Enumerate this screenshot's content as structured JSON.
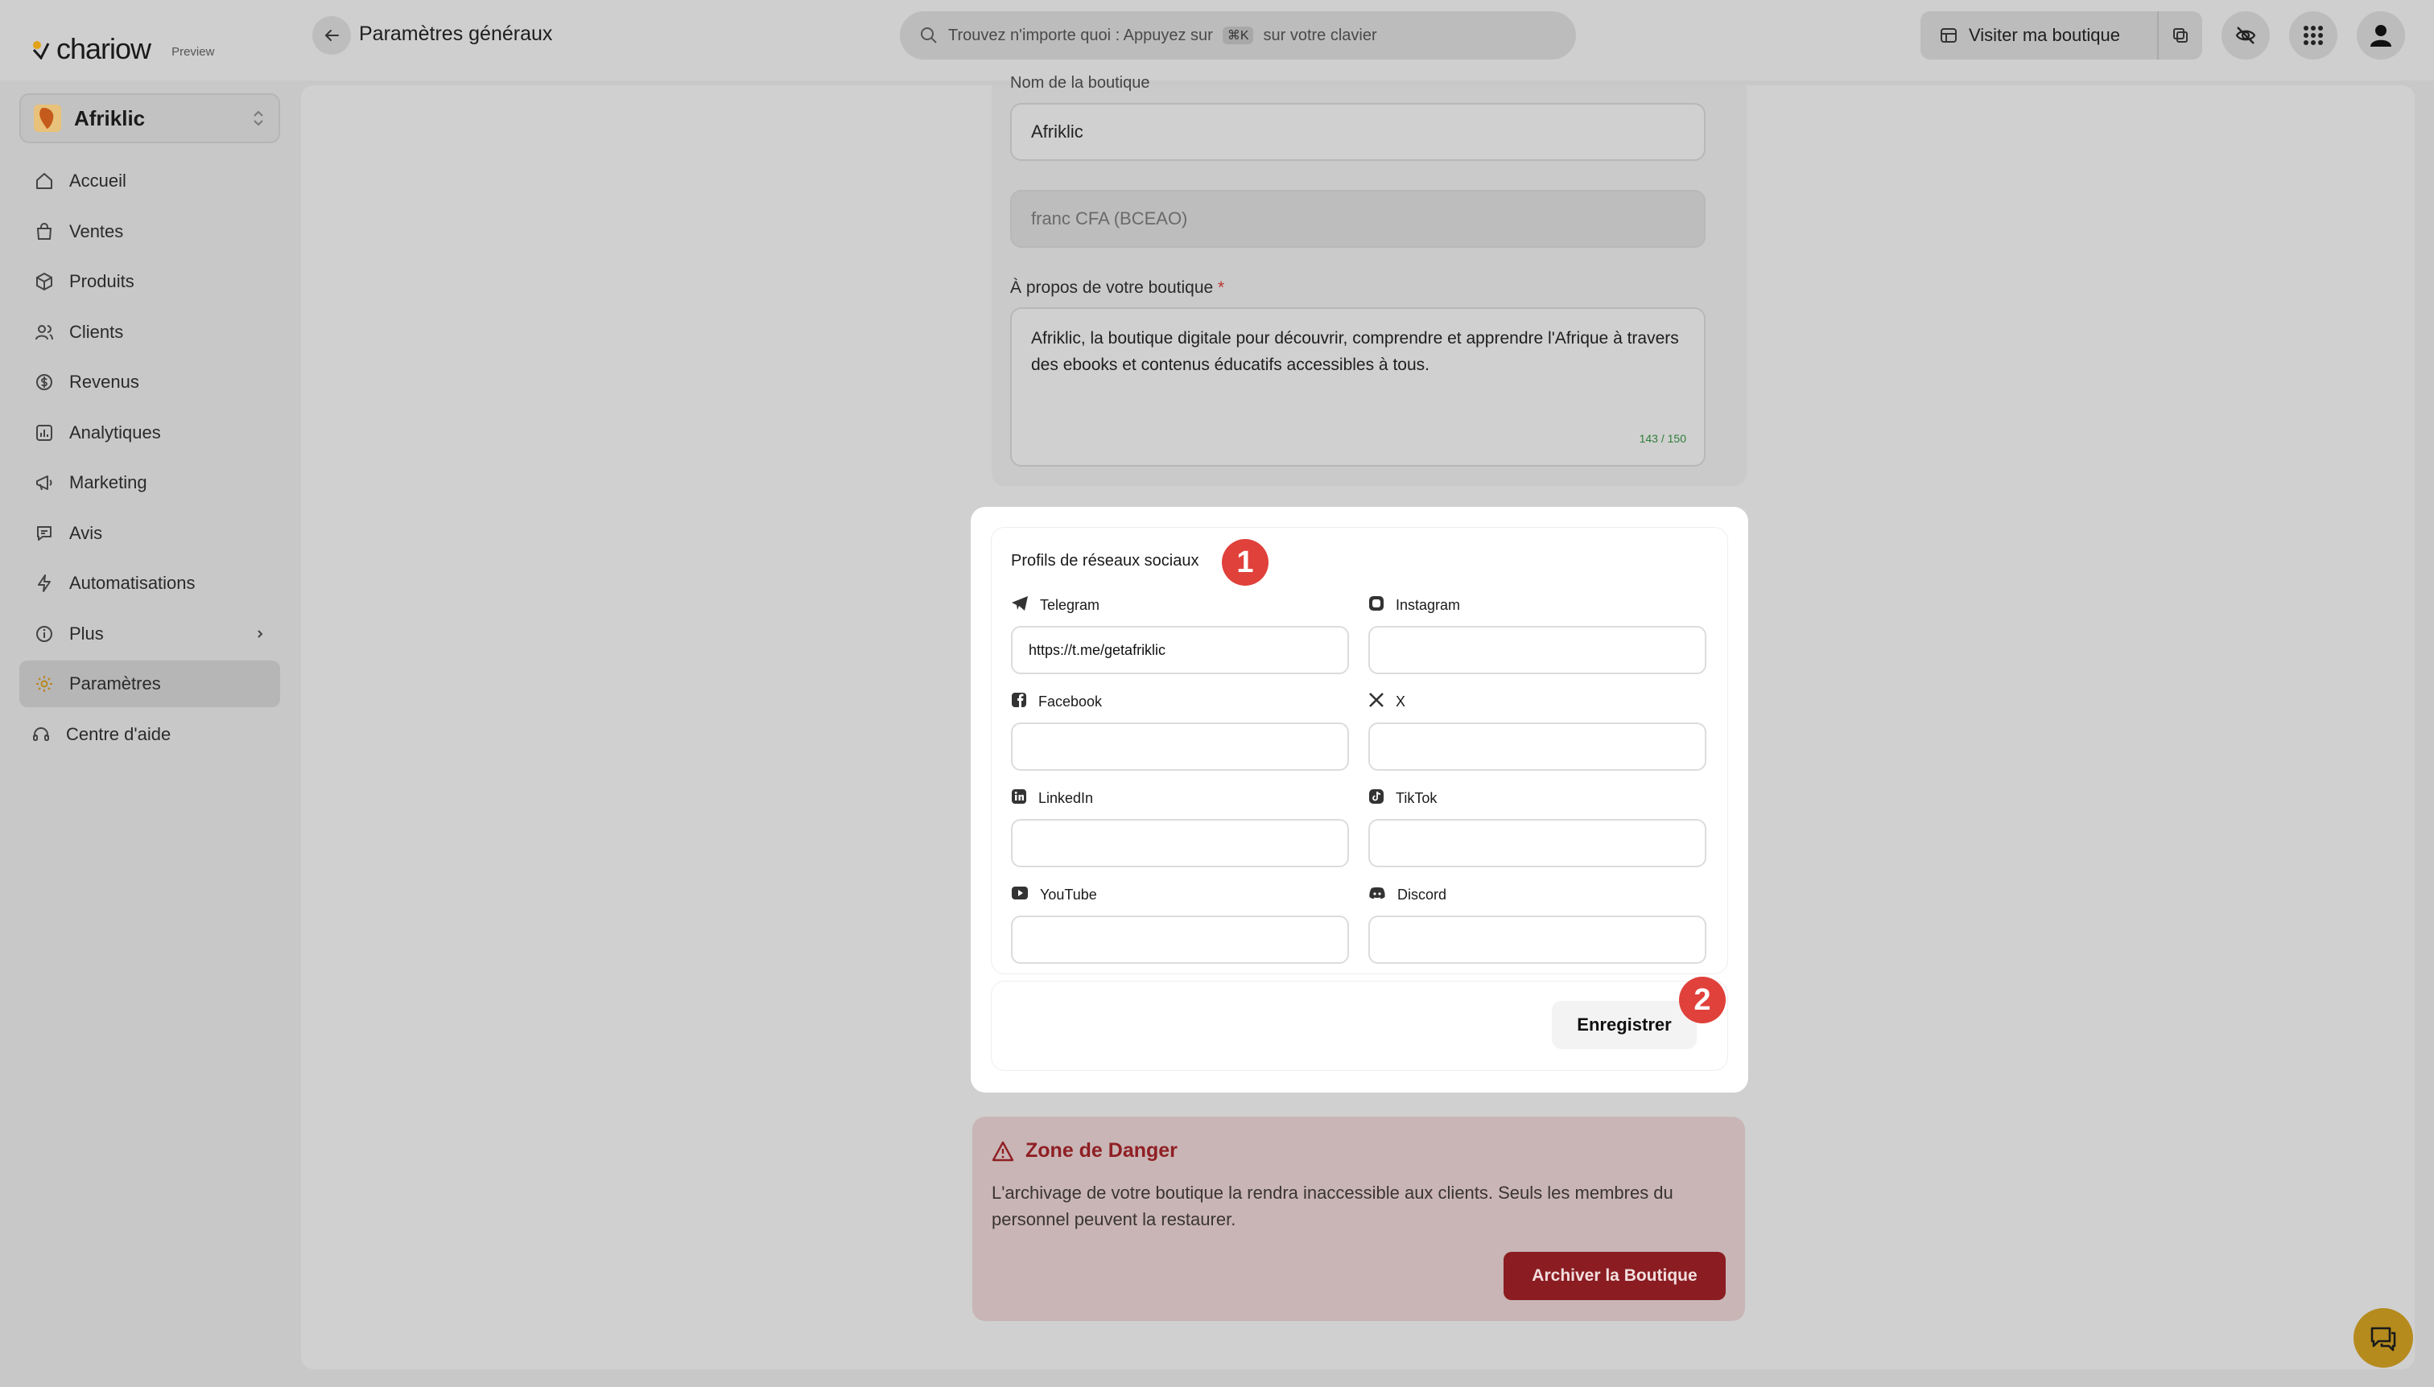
{
  "brand": {
    "name": "chariow",
    "badge": "Preview"
  },
  "header": {
    "title": "Paramètres généraux",
    "search_placeholder_before": "Trouvez n'importe quoi : Appuyez sur",
    "search_shortcut": "⌘K",
    "search_placeholder_after": "sur votre clavier",
    "visit_label": "Visiter ma boutique"
  },
  "store": {
    "name": "Afriklic"
  },
  "sidebar": {
    "items": [
      {
        "label": "Accueil",
        "icon": "home-icon"
      },
      {
        "label": "Ventes",
        "icon": "bag-icon"
      },
      {
        "label": "Produits",
        "icon": "box-icon"
      },
      {
        "label": "Clients",
        "icon": "users-icon"
      },
      {
        "label": "Revenus",
        "icon": "revenue-icon"
      },
      {
        "label": "Analytiques",
        "icon": "chart-icon"
      },
      {
        "label": "Marketing",
        "icon": "marketing-icon"
      },
      {
        "label": "Avis",
        "icon": "review-icon"
      },
      {
        "label": "Automatisations",
        "icon": "bolt-icon"
      },
      {
        "label": "Plus",
        "icon": "info-icon"
      },
      {
        "label": "Paramètres",
        "icon": "gear-icon",
        "active": true
      }
    ],
    "help_label": "Centre d'aide"
  },
  "form": {
    "store_name_label": "Nom de la boutique",
    "store_name_value": "Afriklic",
    "currency_value": "franc CFA (BCEAO)",
    "about_label": "À propos de votre boutique",
    "about_required": "*",
    "about_value": "Afriklic, la boutique digitale pour découvrir, comprendre et apprendre l'Afrique à travers des ebooks et contenus éducatifs accessibles à tous.",
    "about_counter": "143 / 150"
  },
  "social": {
    "title": "Profils de réseaux sociaux",
    "fields": [
      {
        "label": "Telegram",
        "value": "https://t.me/getafriklic",
        "icon": "telegram-icon"
      },
      {
        "label": "Instagram",
        "value": "",
        "icon": "instagram-icon"
      },
      {
        "label": "Facebook",
        "value": "",
        "icon": "facebook-icon"
      },
      {
        "label": "X",
        "value": "",
        "icon": "x-icon"
      },
      {
        "label": "LinkedIn",
        "value": "",
        "icon": "linkedin-icon"
      },
      {
        "label": "TikTok",
        "value": "",
        "icon": "tiktok-icon"
      },
      {
        "label": "YouTube",
        "value": "",
        "icon": "youtube-icon"
      },
      {
        "label": "Discord",
        "value": "",
        "icon": "discord-icon"
      }
    ],
    "save_label": "Enregistrer"
  },
  "annotations": {
    "step1": "1",
    "step2": "2"
  },
  "danger": {
    "title": "Zone de Danger",
    "text": "L'archivage de votre boutique la rendra inaccessible aux clients. Seuls les membres du personnel peuvent la restaurer.",
    "button": "Archiver la Boutique"
  },
  "colors": {
    "badge": "#e0413b",
    "danger": "#8a1c22",
    "counter": "#2f7d3a",
    "fab": "#b58b1e"
  }
}
